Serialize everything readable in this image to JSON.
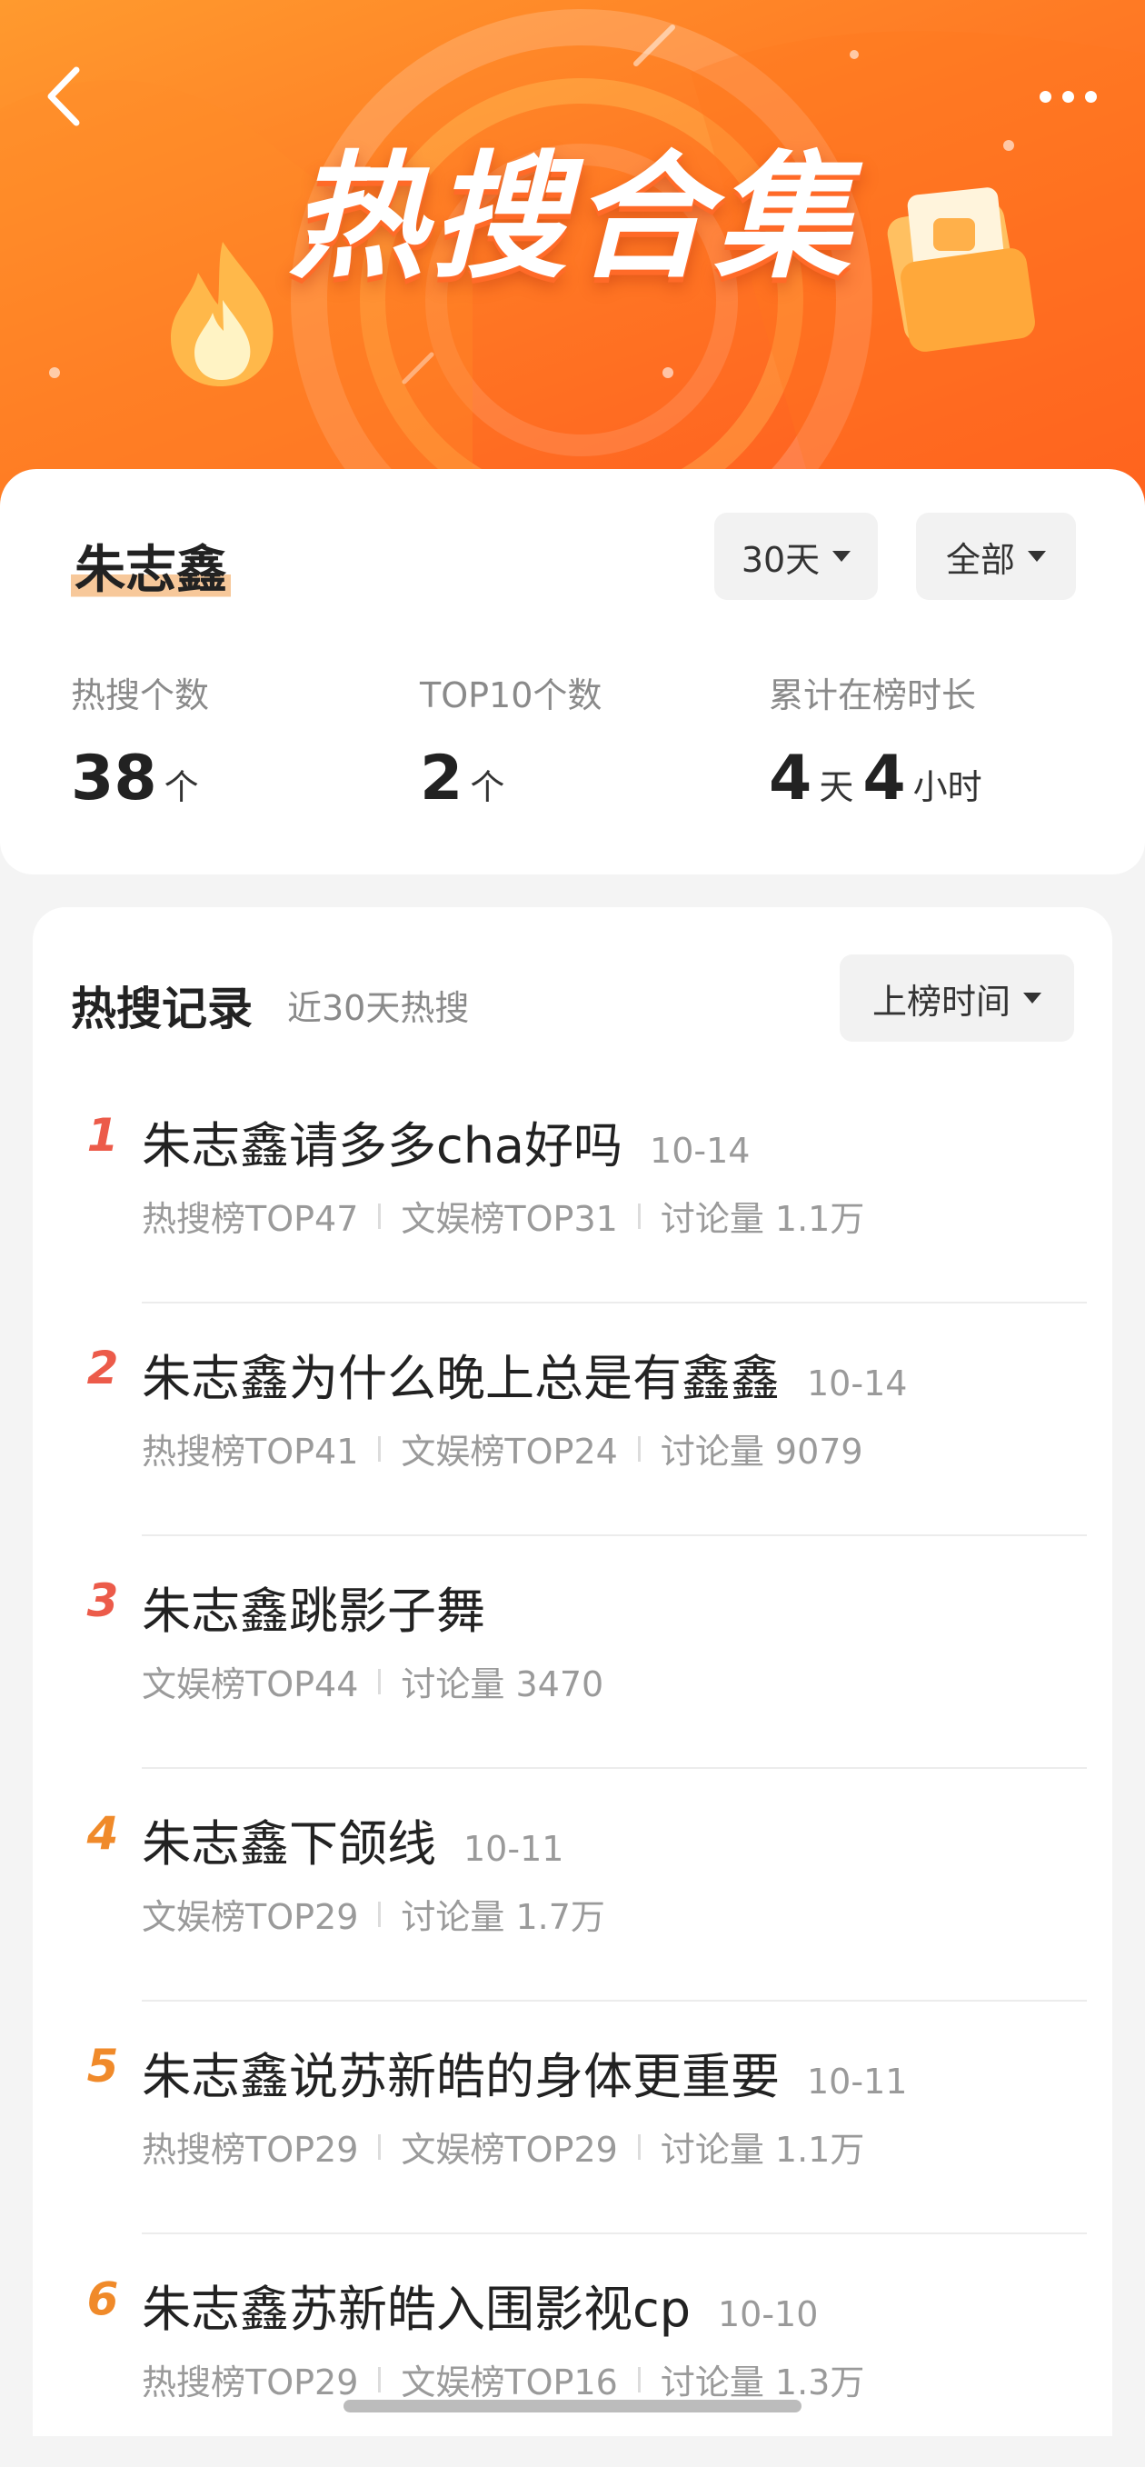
{
  "header": {
    "title": "热搜合集",
    "back_icon": "chevron-left-icon",
    "more_icon": "more-dots-icon"
  },
  "summary": {
    "name": "朱志鑫",
    "period_filter": "30天",
    "type_filter": "全部",
    "stats": [
      {
        "label": "热搜个数",
        "value": "38",
        "unit": "个"
      },
      {
        "label": "TOP10个数",
        "value": "2",
        "unit": "个"
      },
      {
        "label": "累计在榜时长",
        "days": "4",
        "days_unit": "天",
        "hours": "4",
        "hours_unit": "小时"
      }
    ]
  },
  "records": {
    "title": "热搜记录",
    "subtitle": "近30天热搜",
    "sort_label": "上榜时间",
    "items": [
      {
        "rank": "1",
        "title": "朱志鑫请多多cha好吗",
        "date": "10-14",
        "meta": [
          "热搜榜TOP47",
          "文娱榜TOP31",
          "讨论量 1.1万"
        ]
      },
      {
        "rank": "2",
        "title": "朱志鑫为什么晚上总是有鑫鑫",
        "date": "10-14",
        "meta": [
          "热搜榜TOP41",
          "文娱榜TOP24",
          "讨论量 9079"
        ]
      },
      {
        "rank": "3",
        "title": "朱志鑫跳影子舞",
        "date": "",
        "meta": [
          "文娱榜TOP44",
          "讨论量 3470"
        ]
      },
      {
        "rank": "4",
        "title": "朱志鑫下颌线",
        "date": "10-11",
        "meta": [
          "文娱榜TOP29",
          "讨论量 1.7万"
        ]
      },
      {
        "rank": "5",
        "title": "朱志鑫说苏新皓的身体更重要",
        "date": "10-11",
        "meta": [
          "热搜榜TOP29",
          "文娱榜TOP29",
          "讨论量 1.1万"
        ]
      },
      {
        "rank": "6",
        "title": "朱志鑫苏新皓入围影视cp",
        "date": "10-10",
        "meta": [
          "热搜榜TOP29",
          "文娱榜TOP16",
          "讨论量 1.3万"
        ]
      }
    ]
  },
  "colors": {
    "banner_start": "#ff9a2e",
    "banner_end": "#ff5a1f",
    "rank_top3": "#ec5b4a",
    "rank_other": "#f08a2a"
  }
}
